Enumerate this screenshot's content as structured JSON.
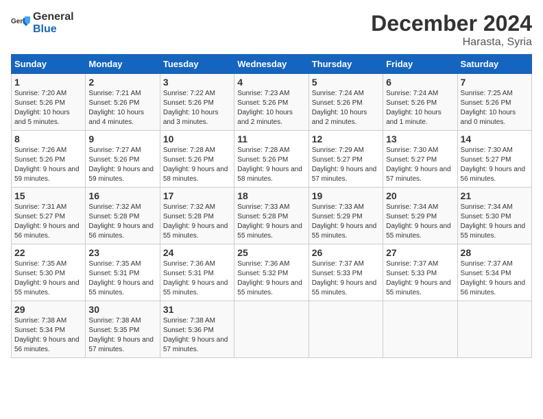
{
  "header": {
    "logo_general": "General",
    "logo_blue": "Blue",
    "month_title": "December 2024",
    "location": "Harasta, Syria"
  },
  "weekdays": [
    "Sunday",
    "Monday",
    "Tuesday",
    "Wednesday",
    "Thursday",
    "Friday",
    "Saturday"
  ],
  "weeks": [
    [
      {
        "day": "1",
        "sunrise": "7:20 AM",
        "sunset": "5:26 PM",
        "daylight": "10 hours and 5 minutes."
      },
      {
        "day": "2",
        "sunrise": "7:21 AM",
        "sunset": "5:26 PM",
        "daylight": "10 hours and 4 minutes."
      },
      {
        "day": "3",
        "sunrise": "7:22 AM",
        "sunset": "5:26 PM",
        "daylight": "10 hours and 3 minutes."
      },
      {
        "day": "4",
        "sunrise": "7:23 AM",
        "sunset": "5:26 PM",
        "daylight": "10 hours and 2 minutes."
      },
      {
        "day": "5",
        "sunrise": "7:24 AM",
        "sunset": "5:26 PM",
        "daylight": "10 hours and 2 minutes."
      },
      {
        "day": "6",
        "sunrise": "7:24 AM",
        "sunset": "5:26 PM",
        "daylight": "10 hours and 1 minute."
      },
      {
        "day": "7",
        "sunrise": "7:25 AM",
        "sunset": "5:26 PM",
        "daylight": "10 hours and 0 minutes."
      }
    ],
    [
      {
        "day": "8",
        "sunrise": "7:26 AM",
        "sunset": "5:26 PM",
        "daylight": "9 hours and 59 minutes."
      },
      {
        "day": "9",
        "sunrise": "7:27 AM",
        "sunset": "5:26 PM",
        "daylight": "9 hours and 59 minutes."
      },
      {
        "day": "10",
        "sunrise": "7:28 AM",
        "sunset": "5:26 PM",
        "daylight": "9 hours and 58 minutes."
      },
      {
        "day": "11",
        "sunrise": "7:28 AM",
        "sunset": "5:26 PM",
        "daylight": "9 hours and 58 minutes."
      },
      {
        "day": "12",
        "sunrise": "7:29 AM",
        "sunset": "5:27 PM",
        "daylight": "9 hours and 57 minutes."
      },
      {
        "day": "13",
        "sunrise": "7:30 AM",
        "sunset": "5:27 PM",
        "daylight": "9 hours and 57 minutes."
      },
      {
        "day": "14",
        "sunrise": "7:30 AM",
        "sunset": "5:27 PM",
        "daylight": "9 hours and 56 minutes."
      }
    ],
    [
      {
        "day": "15",
        "sunrise": "7:31 AM",
        "sunset": "5:27 PM",
        "daylight": "9 hours and 56 minutes."
      },
      {
        "day": "16",
        "sunrise": "7:32 AM",
        "sunset": "5:28 PM",
        "daylight": "9 hours and 56 minutes."
      },
      {
        "day": "17",
        "sunrise": "7:32 AM",
        "sunset": "5:28 PM",
        "daylight": "9 hours and 55 minutes."
      },
      {
        "day": "18",
        "sunrise": "7:33 AM",
        "sunset": "5:28 PM",
        "daylight": "9 hours and 55 minutes."
      },
      {
        "day": "19",
        "sunrise": "7:33 AM",
        "sunset": "5:29 PM",
        "daylight": "9 hours and 55 minutes."
      },
      {
        "day": "20",
        "sunrise": "7:34 AM",
        "sunset": "5:29 PM",
        "daylight": "9 hours and 55 minutes."
      },
      {
        "day": "21",
        "sunrise": "7:34 AM",
        "sunset": "5:30 PM",
        "daylight": "9 hours and 55 minutes."
      }
    ],
    [
      {
        "day": "22",
        "sunrise": "7:35 AM",
        "sunset": "5:30 PM",
        "daylight": "9 hours and 55 minutes."
      },
      {
        "day": "23",
        "sunrise": "7:35 AM",
        "sunset": "5:31 PM",
        "daylight": "9 hours and 55 minutes."
      },
      {
        "day": "24",
        "sunrise": "7:36 AM",
        "sunset": "5:31 PM",
        "daylight": "9 hours and 55 minutes."
      },
      {
        "day": "25",
        "sunrise": "7:36 AM",
        "sunset": "5:32 PM",
        "daylight": "9 hours and 55 minutes."
      },
      {
        "day": "26",
        "sunrise": "7:37 AM",
        "sunset": "5:33 PM",
        "daylight": "9 hours and 55 minutes."
      },
      {
        "day": "27",
        "sunrise": "7:37 AM",
        "sunset": "5:33 PM",
        "daylight": "9 hours and 55 minutes."
      },
      {
        "day": "28",
        "sunrise": "7:37 AM",
        "sunset": "5:34 PM",
        "daylight": "9 hours and 56 minutes."
      }
    ],
    [
      {
        "day": "29",
        "sunrise": "7:38 AM",
        "sunset": "5:34 PM",
        "daylight": "9 hours and 56 minutes."
      },
      {
        "day": "30",
        "sunrise": "7:38 AM",
        "sunset": "5:35 PM",
        "daylight": "9 hours and 57 minutes."
      },
      {
        "day": "31",
        "sunrise": "7:38 AM",
        "sunset": "5:36 PM",
        "daylight": "9 hours and 57 minutes."
      },
      null,
      null,
      null,
      null
    ]
  ],
  "labels": {
    "sunrise": "Sunrise:",
    "sunset": "Sunset:",
    "daylight": "Daylight:"
  }
}
